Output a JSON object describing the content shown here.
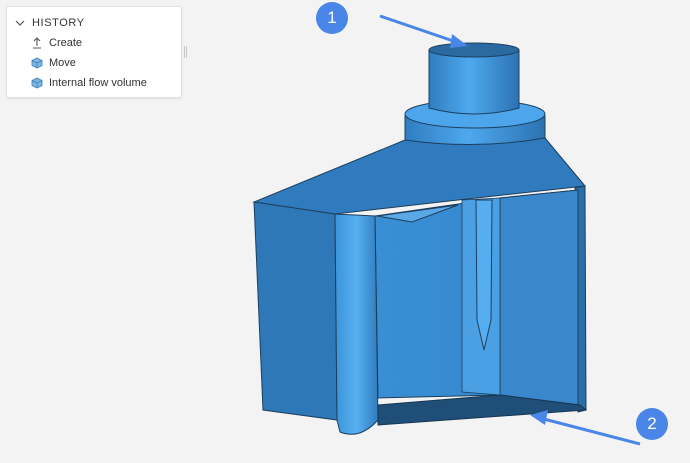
{
  "history": {
    "title": "HISTORY",
    "items": [
      {
        "label": "Create",
        "icon": "upload-icon"
      },
      {
        "label": "Move",
        "icon": "cube-icon"
      },
      {
        "label": "Internal flow volume",
        "icon": "cube-icon"
      }
    ]
  },
  "annotations": {
    "callout_1": "1",
    "callout_2": "2"
  },
  "colors": {
    "model_main": "#3a8fd4",
    "model_dark": "#2a6ea6",
    "model_light": "#4fa8ee",
    "callout": "#4a86e8"
  }
}
